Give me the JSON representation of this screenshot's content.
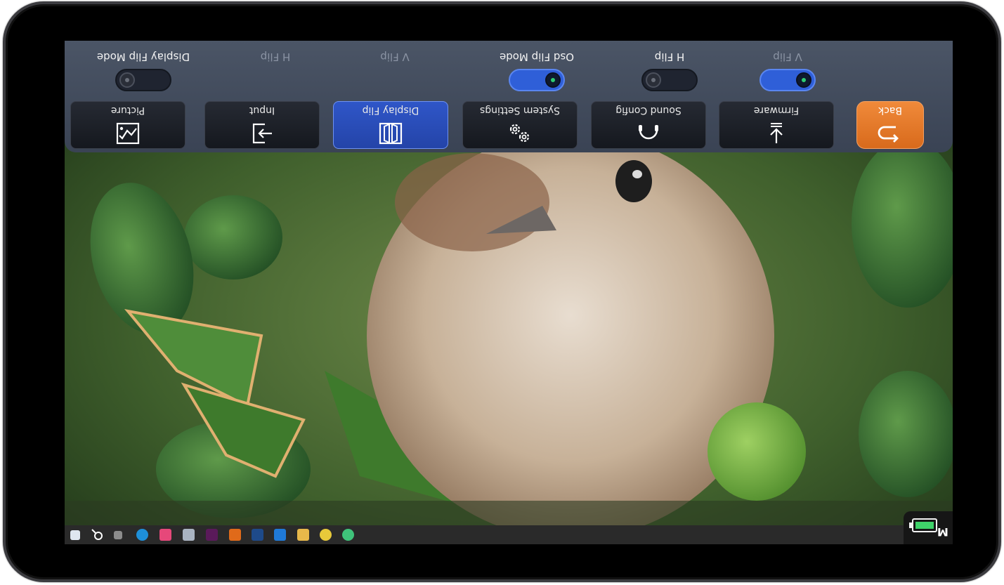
{
  "osd": {
    "toggles": [
      {
        "label": "Display Flip Mode",
        "state": "off",
        "dim": false,
        "icon": "toggle-switch"
      },
      {
        "label": "H Flip",
        "state": "none",
        "dim": true
      },
      {
        "label": "V Flip",
        "state": "none",
        "dim": true
      },
      {
        "label": "Osd Flip Mode",
        "state": "on",
        "dim": false,
        "icon": "toggle-switch"
      },
      {
        "label": "H Flip",
        "state": "off",
        "dim": false,
        "icon": "toggle-switch"
      },
      {
        "label": "V Flip",
        "state": "on",
        "dim": true,
        "icon": "toggle-switch"
      }
    ],
    "tabs": [
      {
        "label": "Picture",
        "icon": "picture-icon",
        "active": false
      },
      {
        "label": "Input",
        "icon": "input-icon",
        "active": false
      },
      {
        "label": "Display Flip",
        "icon": "display-flip-icon",
        "active": true
      },
      {
        "label": "System Settings",
        "icon": "gears-icon",
        "active": false
      },
      {
        "label": "Sound Config",
        "icon": "headphones-icon",
        "active": false
      },
      {
        "label": "Firmware",
        "icon": "download-icon",
        "active": false
      },
      {
        "label": "Back",
        "icon": "return-icon",
        "active": false
      }
    ]
  },
  "taskbar": {
    "icons": [
      "windows-start-icon",
      "search-icon",
      "task-view-icon",
      "edge-icon",
      "app-pink-icon",
      "calculator-icon",
      "xd-icon",
      "ai-icon",
      "ps-icon",
      "app-blue-icon",
      "file-explorer-icon",
      "chrome-icon",
      "wechat-icon"
    ],
    "tray_label": "M"
  },
  "colors": {
    "menu_bg": "#4b5566",
    "active_tab": "#2f56c8",
    "back_button": "#f08a3a",
    "toggle_on": "#2f5fd8",
    "indicator_green": "#2ecc71"
  }
}
